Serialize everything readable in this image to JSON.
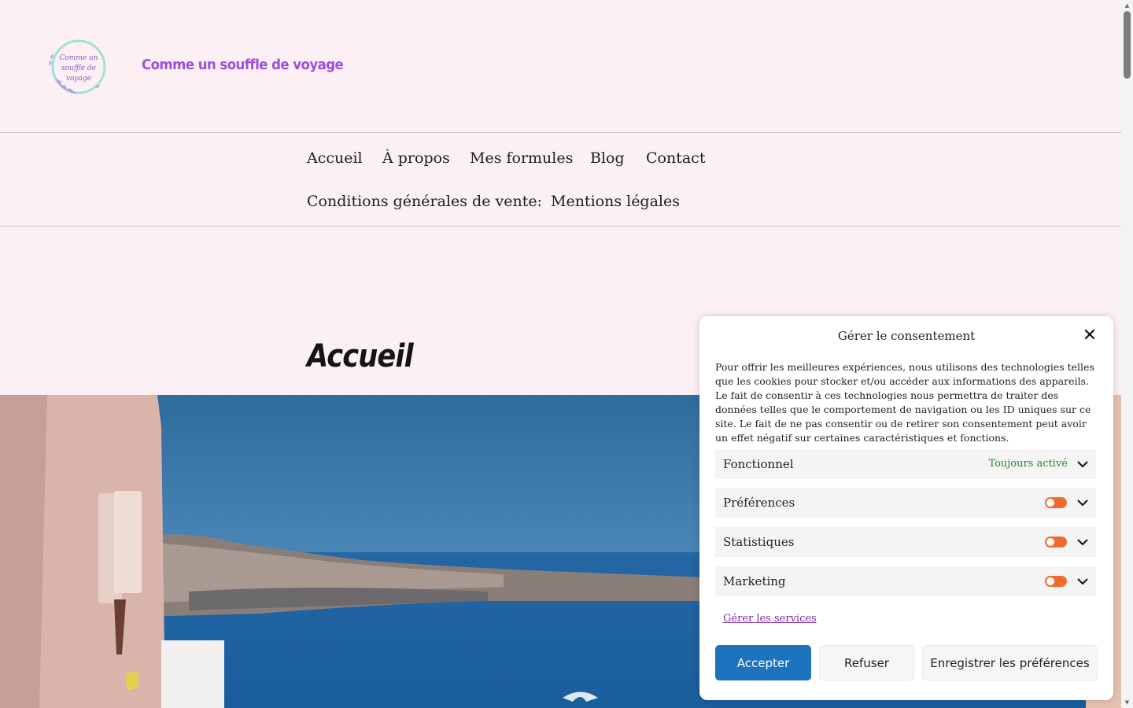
{
  "header": {
    "logo_text": "Comme un souffle de voyage",
    "site_title": "Comme un souffle de voyage"
  },
  "nav": {
    "items": [
      "Accueil",
      "À propos",
      "Mes formules",
      "Blog",
      "Contact",
      "Conditions générales de vente:",
      "Mentions légales"
    ]
  },
  "page": {
    "title": "Accueil"
  },
  "cookie_banner": {
    "title": "Gérer le consentement",
    "text": "Pour offrir les meilleures expériences, nous utilisons des technologies telles que les cookies pour stocker et/ou accéder aux informations des appareils. Le fait de consentir à ces technologies nous permettra de traiter des données telles que le comportement de navigation ou les ID uniques sur ce site. Le fait de ne pas consentir ou de retirer son consentement peut avoir un effet négatif sur certaines caractéristiques et fonctions.",
    "categories": [
      {
        "label": "Fonctionnel",
        "status": "Toujours activé"
      },
      {
        "label": "Préférences",
        "enabled": false
      },
      {
        "label": "Statistiques",
        "enabled": false
      },
      {
        "label": "Marketing",
        "enabled": false
      }
    ],
    "manage_link": "Gérer les services",
    "accept": "Accepter",
    "deny": "Refuser",
    "save": "Enregistrer les préférences"
  },
  "colors": {
    "background": "#fdf0f4",
    "site_title": "#9b4fe0",
    "accept_button": "#1e73be",
    "toggle": "#ef6c2e",
    "always_active": "#1e8a2c"
  },
  "icons": [
    "close-icon",
    "chevron-down-icon"
  ]
}
